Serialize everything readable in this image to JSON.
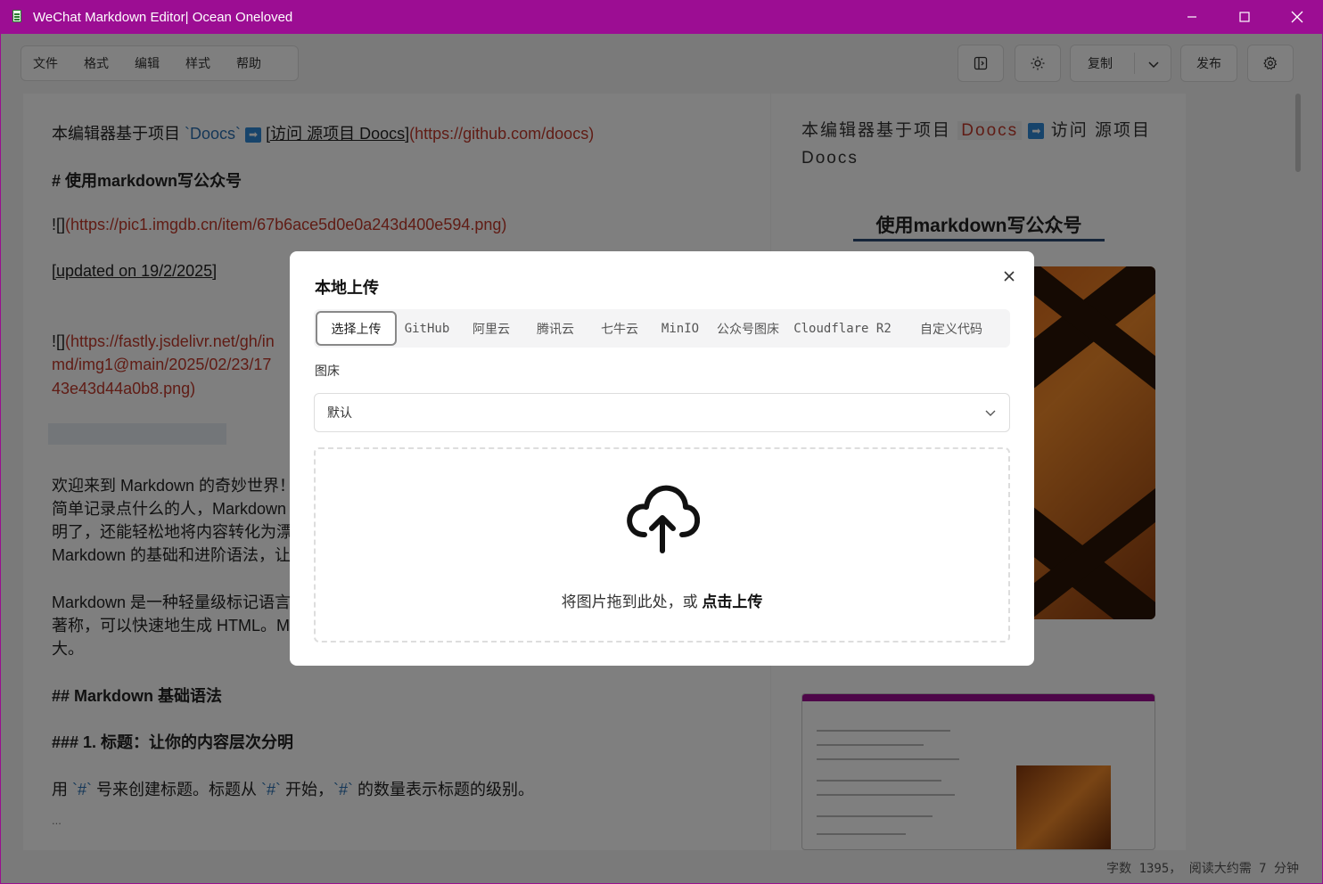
{
  "window": {
    "title": "WeChat Markdown Editor| Ocean Oneloved"
  },
  "menubar": {
    "items": [
      "文件",
      "格式",
      "编辑",
      "样式",
      "帮助"
    ]
  },
  "toolbar": {
    "copy_label": "复制",
    "publish_label": "发布"
  },
  "editor": {
    "line1_prefix": "本编辑器基于项目 ",
    "line1_code": "`Doocs`",
    "line1_arrow": "➡",
    "line1_link_text": "[访问 源项目 Doocs]",
    "line1_link_url": "(https://github.com/doocs)",
    "h1": "# 使用markdown写公众号",
    "img1_prefix": "![]",
    "img1_url": "(https://pic1.imgdb.cn/item/67b6ace5d0e0a243d400e594.png)",
    "updated": "[updated on 19/2/2025]",
    "img2_prefix": "![]",
    "img2_url_1": "(https://fastly.jsdelivr.net/gh/in",
    "img2_url_2": "md/img1@main/2025/02/23/17",
    "img2_url_3": "43e43d44a0b8.png)",
    "p1_1": "欢迎来到 Markdown 的奇妙世界！",
    "p1_2": "简单记录点什么的人，Markdown",
    "p1_3": "明了，还能轻松地将内容转化为漂亮",
    "p1_4": "Markdown 的基础和进阶语法，让",
    "p2_1": "Markdown 是一种轻量级标记语言",
    "p2_2": "著称，可以快速地生成 HTML。Ma",
    "p2_3": "大。",
    "h2": "## Markdown 基础语法",
    "h3": "### 1. 标题：让你的内容层次分明",
    "p3_a": "用 ",
    "p3_code1": "`#`",
    "p3_b": " 号来创建标题。标题从 ",
    "p3_code2": "`#`",
    "p3_c": " 开始，",
    "p3_code3": "`#`",
    "p3_d": " 的数量表示标题的级别。",
    "ellipsis": "..."
  },
  "preview": {
    "intro_prefix": "本编辑器基于项目",
    "intro_tag": "Doocs",
    "intro_arrow": "➡",
    "intro_suffix": "访问 源项目 Doocs",
    "h1": "使用markdown写公众号"
  },
  "statusbar": {
    "text": "字数 1395， 阅读大约需 7 分钟"
  },
  "modal": {
    "title": "本地上传",
    "tabs": [
      "选择上传",
      "GitHub",
      "阿里云",
      "腾讯云",
      "七牛云",
      "MinIO",
      "公众号图床",
      "Cloudflare R2",
      "自定义代码"
    ],
    "active_tab": "选择上传",
    "field_label": "图床",
    "select_value": "默认",
    "dropzone_text": "将图片拖到此处，或 ",
    "dropzone_link": "点击上传"
  },
  "colors": {
    "titlebar": "#9c0d93",
    "accent_link": "#c0392b",
    "code": "#2a6fb0"
  }
}
